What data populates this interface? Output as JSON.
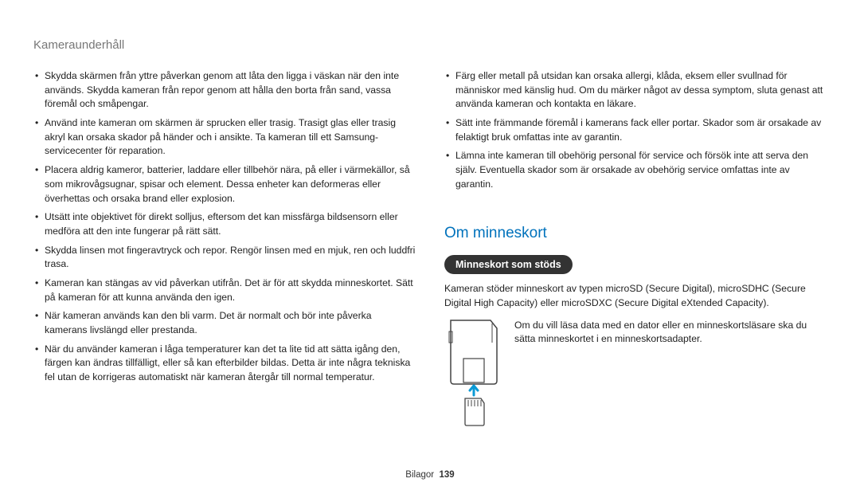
{
  "header": "Kameraunderhåll",
  "leftBullets": [
    "Skydda skärmen från yttre påverkan genom att låta den ligga i väskan när den inte används. Skydda kameran från repor genom att hålla den borta från sand, vassa föremål och småpengar.",
    "Använd inte kameran om skärmen är sprucken eller trasig. Trasigt glas eller trasig akryl kan orsaka skador på händer och i ansikte. Ta kameran till ett Samsung-servicecenter för reparation.",
    "Placera aldrig kameror, batterier, laddare eller tillbehör nära, på eller i värmekällor, så som mikrovågsugnar, spisar och element. Dessa enheter kan deformeras eller överhettas och orsaka brand eller explosion.",
    "Utsätt inte objektivet för direkt solljus, eftersom det kan missfärga bildsensorn eller medföra att den inte fungerar på rätt sätt.",
    "Skydda linsen mot fingeravtryck och repor. Rengör linsen med en mjuk, ren och luddfri trasa.",
    "Kameran kan stängas av vid påverkan utifrån. Det är för att skydda minneskortet. Sätt på kameran för att kunna använda den igen.",
    "När kameran används kan den bli varm. Det är normalt och bör inte påverka kamerans livslängd eller prestanda.",
    "När du använder kameran i låga temperaturer kan det ta lite tid att sätta igång den, färgen kan ändras tillfälligt, eller så kan efterbilder bildas. Detta är inte några tekniska fel utan de korrigeras automatiskt när kameran återgår till normal temperatur."
  ],
  "rightBullets": [
    "Färg eller metall på utsidan kan orsaka allergi, klåda, eksem eller svullnad för människor med känslig hud. Om du märker något av dessa symptom, sluta genast att använda kameran och kontakta en läkare.",
    "Sätt inte främmande föremål i kamerans fack eller portar. Skador som är orsakade av felaktigt bruk omfattas inte av garantin.",
    "Lämna inte kameran till obehörig personal för service och försök inte att serva den själv. Eventuella skador som är orsakade av obehörig service omfattas inte av garantin."
  ],
  "sectionTitle": "Om minneskort",
  "pillLabel": "Minneskort som stöds",
  "supportedText": "Kameran stöder minneskort av typen microSD (Secure Digital), microSDHC (Secure Digital High Capacity) eller microSDXC (Secure Digital eXtended Capacity).",
  "adapterText": "Om du vill läsa data med en dator eller en minneskortsläsare ska du sätta minneskortet i en minneskortsadapter.",
  "footerLabel": "Bilagor",
  "pageNumber": "139"
}
